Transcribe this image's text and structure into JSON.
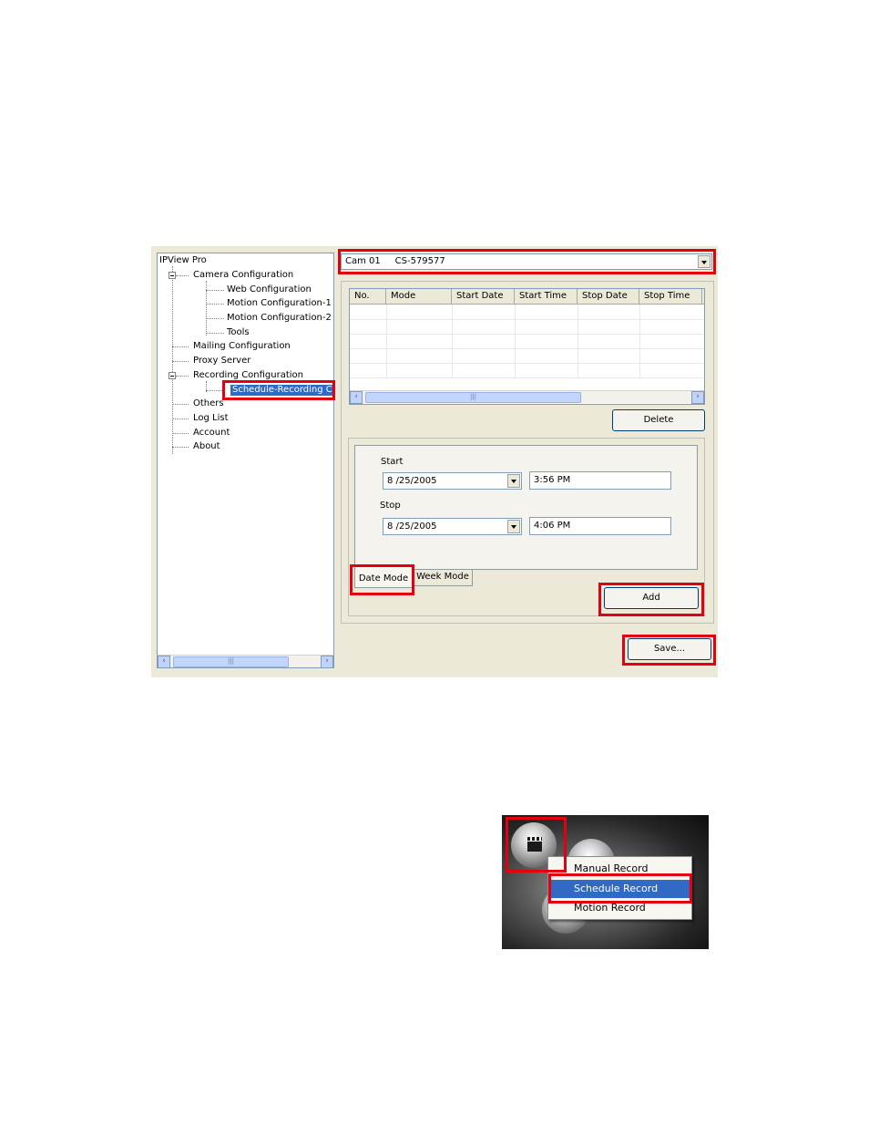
{
  "tree": {
    "root": "IPView Pro",
    "camera_config": "Camera Configuration",
    "web_config": "Web Configuration",
    "motion_config_1": "Motion Configuration-1",
    "motion_config_2": "Motion Configuration-2",
    "tools": "Tools",
    "mailing_config": "Mailing Configuration",
    "proxy_server": "Proxy Server",
    "recording_config": "Recording Configuration",
    "schedule_recording": "Schedule-Recording Cor",
    "others": "Others",
    "log_list": "Log List",
    "account": "Account",
    "about": "About"
  },
  "camera_select": {
    "value": "Cam 01     CS-579577"
  },
  "schedule_table": {
    "columns": [
      "No.",
      "Mode",
      "Start Date",
      "Start Time",
      "Stop Date",
      "Stop Time"
    ],
    "rows": []
  },
  "buttons": {
    "delete": "Delete",
    "add": "Add",
    "save": "Save..."
  },
  "schedule_form": {
    "start_label": "Start",
    "start_date": "8 /25/2005",
    "start_time": "3:56 PM",
    "stop_label": "Stop",
    "stop_date": "8 /25/2005",
    "stop_time": "4:06 PM"
  },
  "tabs": {
    "date_mode": "Date Mode",
    "week_mode": "Week Mode"
  },
  "record_menu": {
    "items": [
      "Manual Record",
      "Schedule Record",
      "Motion Record"
    ],
    "selected": "Schedule Record"
  },
  "colors": {
    "highlight": "#e3000f",
    "selection": "#316ac5",
    "window": "#ece9d8"
  }
}
